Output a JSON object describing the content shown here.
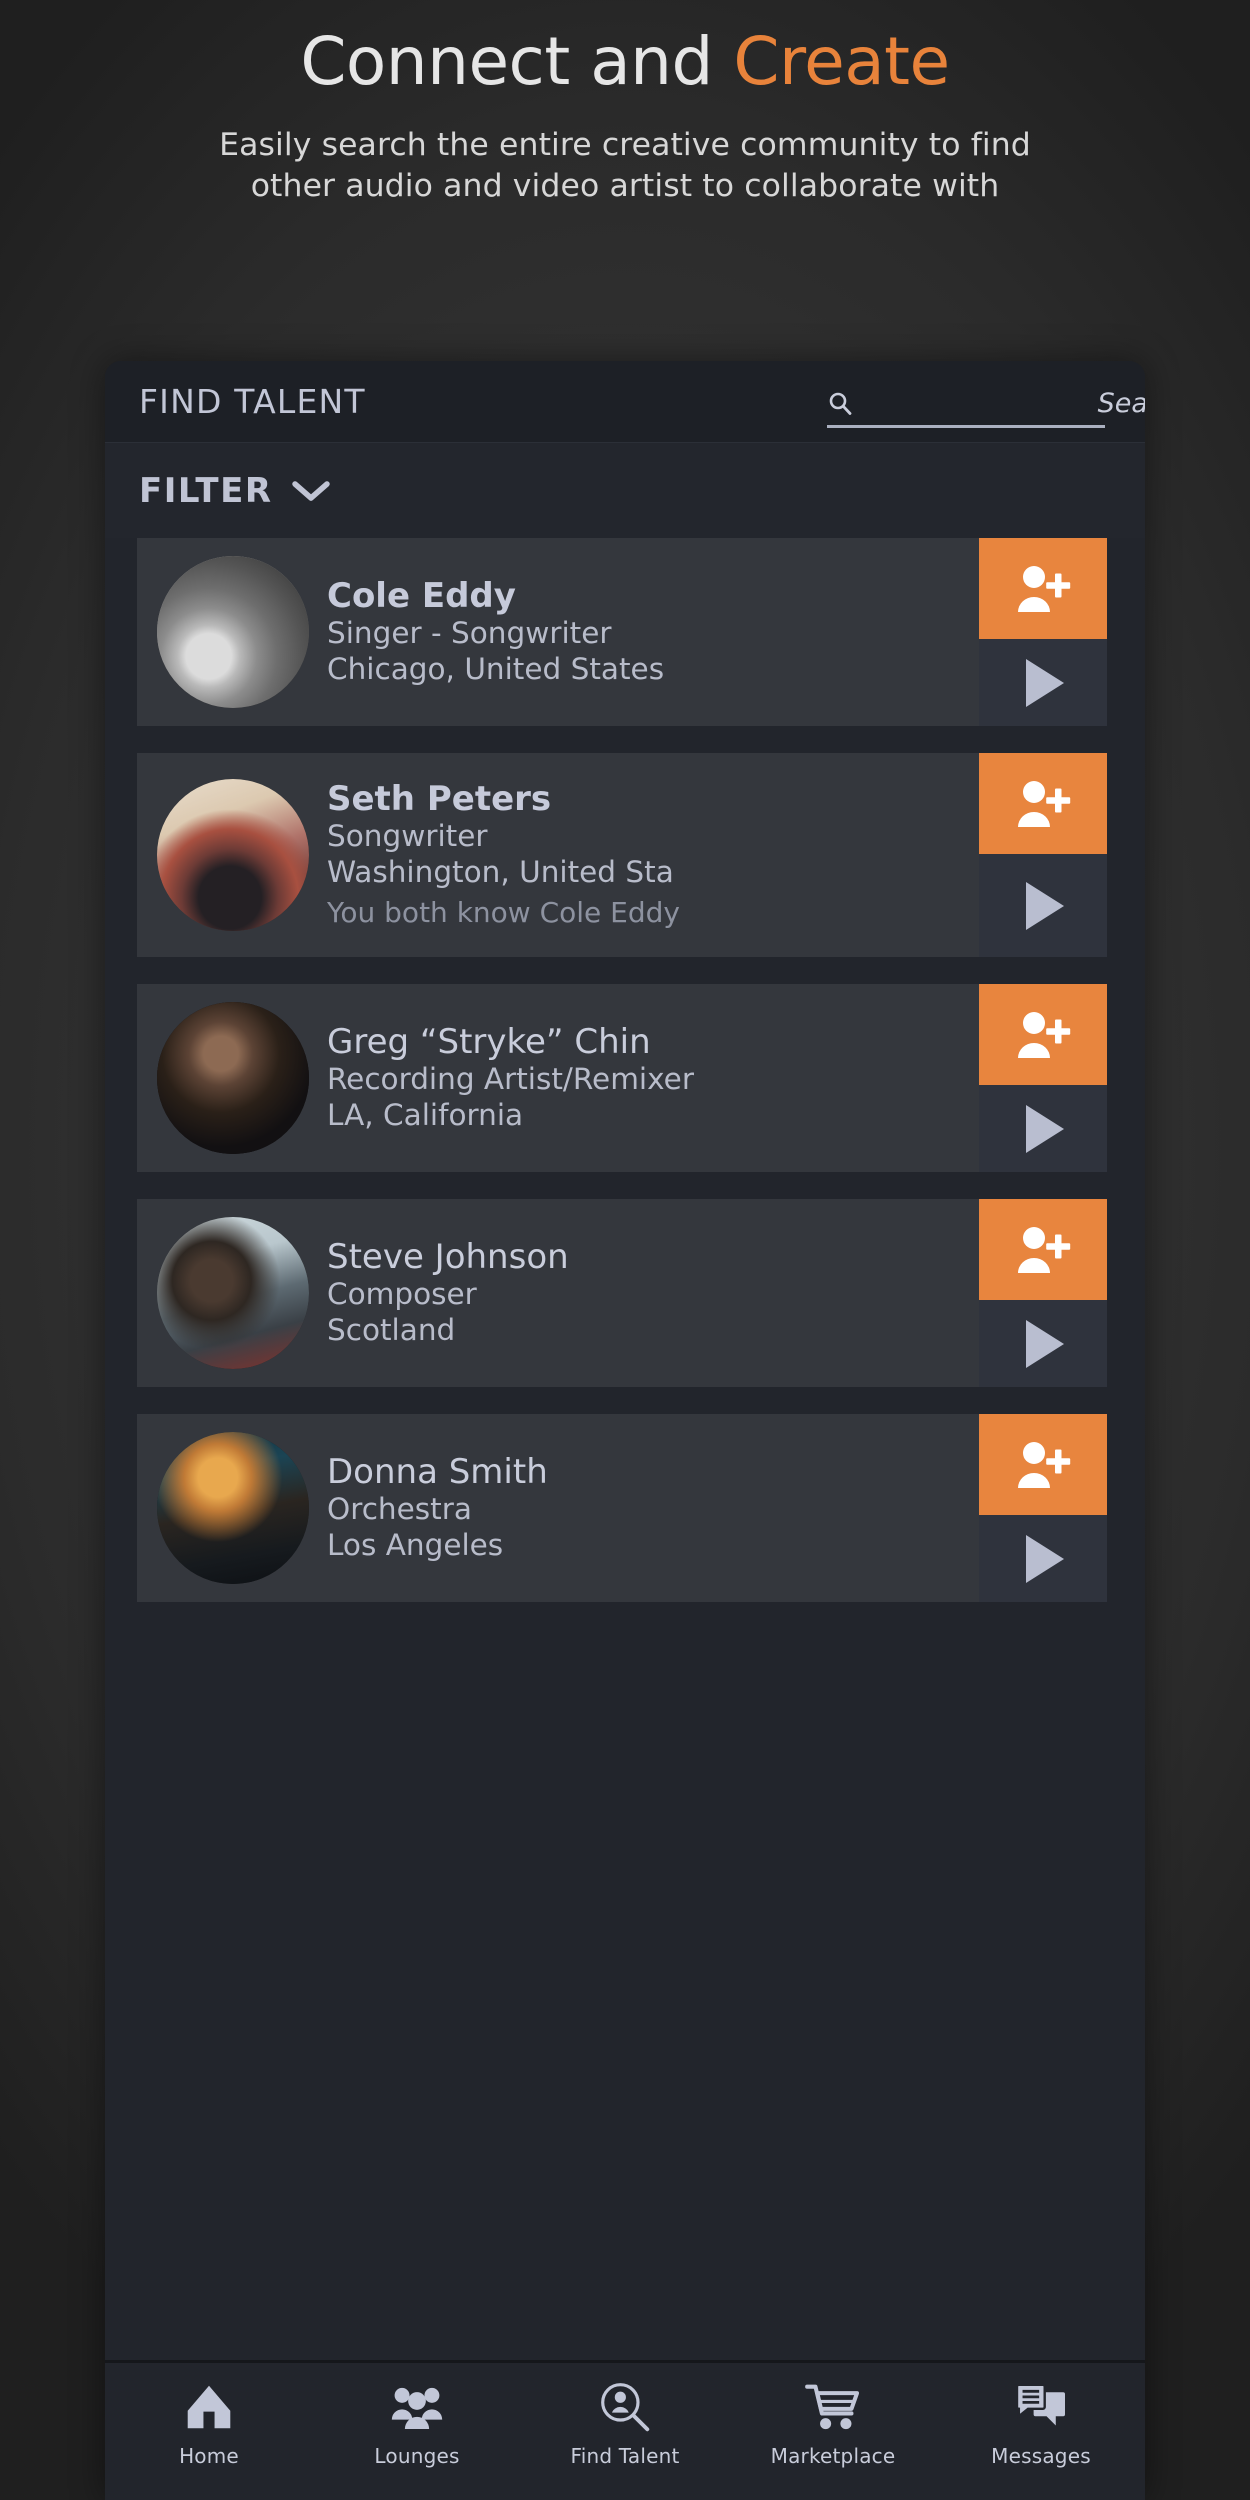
{
  "hero": {
    "title_main": "Connect and ",
    "title_accent": "Create",
    "subtitle_line1": "Easily search the entire creative community to find",
    "subtitle_line2": "other audio and video artist to collaborate with",
    "accent_color": "#e8833b",
    "title_color": "#e6e6e6"
  },
  "app": {
    "header": {
      "title": "FIND TALENT",
      "search_icon": "search-icon",
      "search_value": "",
      "search_placeholder": "Search"
    },
    "filter": {
      "label": "FILTER",
      "chevron_icon": "chevron-down-icon"
    },
    "results": [
      {
        "name": "Cole Eddy",
        "bold_name": true,
        "role": "Singer - Songwriter",
        "location": "Chicago, United States",
        "mutual": "",
        "add_icon": "person-add-icon",
        "play_icon": "play-icon",
        "avatar_name": "avatar-cole-eddy"
      },
      {
        "name": "Seth Peters",
        "bold_name": true,
        "role": "Songwriter",
        "location": "Washington, United Sta",
        "mutual": "You both know Cole Eddy",
        "add_icon": "person-add-icon",
        "play_icon": "play-icon",
        "avatar_name": "avatar-seth-peters"
      },
      {
        "name": "Greg “Stryke” Chin",
        "bold_name": false,
        "role": "Recording Artist/Remixer",
        "location": "LA, California",
        "mutual": "",
        "add_icon": "person-add-icon",
        "play_icon": "play-icon",
        "avatar_name": "avatar-greg-stryke-chin"
      },
      {
        "name": "Steve Johnson",
        "bold_name": false,
        "role": "Composer",
        "location": "Scotland",
        "mutual": "",
        "add_icon": "person-add-icon",
        "play_icon": "play-icon",
        "avatar_name": "avatar-steve-johnson"
      },
      {
        "name": "Donna Smith",
        "bold_name": false,
        "role": "Orchestra",
        "location": "Los Angeles",
        "mutual": "",
        "add_icon": "person-add-icon",
        "play_icon": "play-icon",
        "avatar_name": "avatar-donna-smith"
      }
    ],
    "bottom_nav": [
      {
        "label": "Home",
        "icon": "home-icon"
      },
      {
        "label": "Lounges",
        "icon": "people-group-icon"
      },
      {
        "label": "Find Talent",
        "icon": "person-search-icon"
      },
      {
        "label": "Marketplace",
        "icon": "shopping-cart-icon"
      },
      {
        "label": "Messages",
        "icon": "chat-bubbles-icon"
      }
    ]
  },
  "colors": {
    "accent_orange": "#e8853e",
    "card_bg": "#34373d",
    "panel_bg": "#22252c",
    "header_bg": "#1d2026",
    "play_bg": "#2f333d",
    "text_primary": "#c9cddb",
    "text_secondary": "#b8bcca",
    "text_muted": "#8d92a0"
  }
}
